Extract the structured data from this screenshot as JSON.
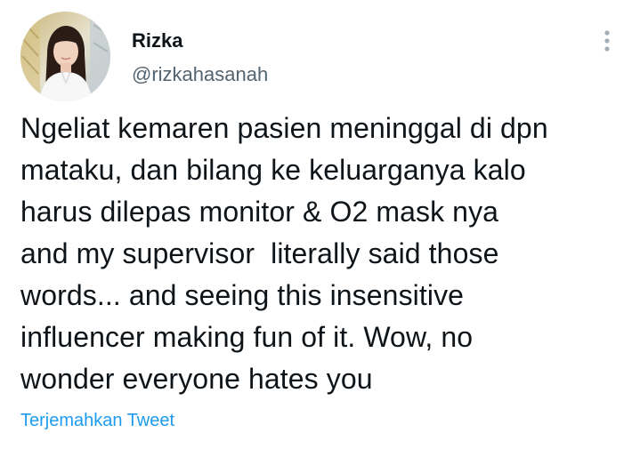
{
  "author": {
    "display_name": "Rizka",
    "handle": "@rizkahasanah",
    "avatar_icon": "profile-photo"
  },
  "menu": {
    "icon": "more-vertical-icon"
  },
  "tweet": {
    "lines": [
      "Ngeliat kemaren pasien meninggal di dpn",
      "mataku, dan bilang ke keluarganya kalo",
      "harus dilepas monitor & O2 mask nya",
      "and my supervisor  literally said those",
      "words... and seeing this insensitive",
      "influencer making fun of it. Wow, no",
      "wonder everyone hates you"
    ]
  },
  "actions": {
    "translate_label": "Terjemahkan Tweet"
  },
  "colors": {
    "text_primary": "#0f1419",
    "text_secondary": "#536471",
    "link": "#1d9bf0",
    "background": "#ffffff"
  }
}
